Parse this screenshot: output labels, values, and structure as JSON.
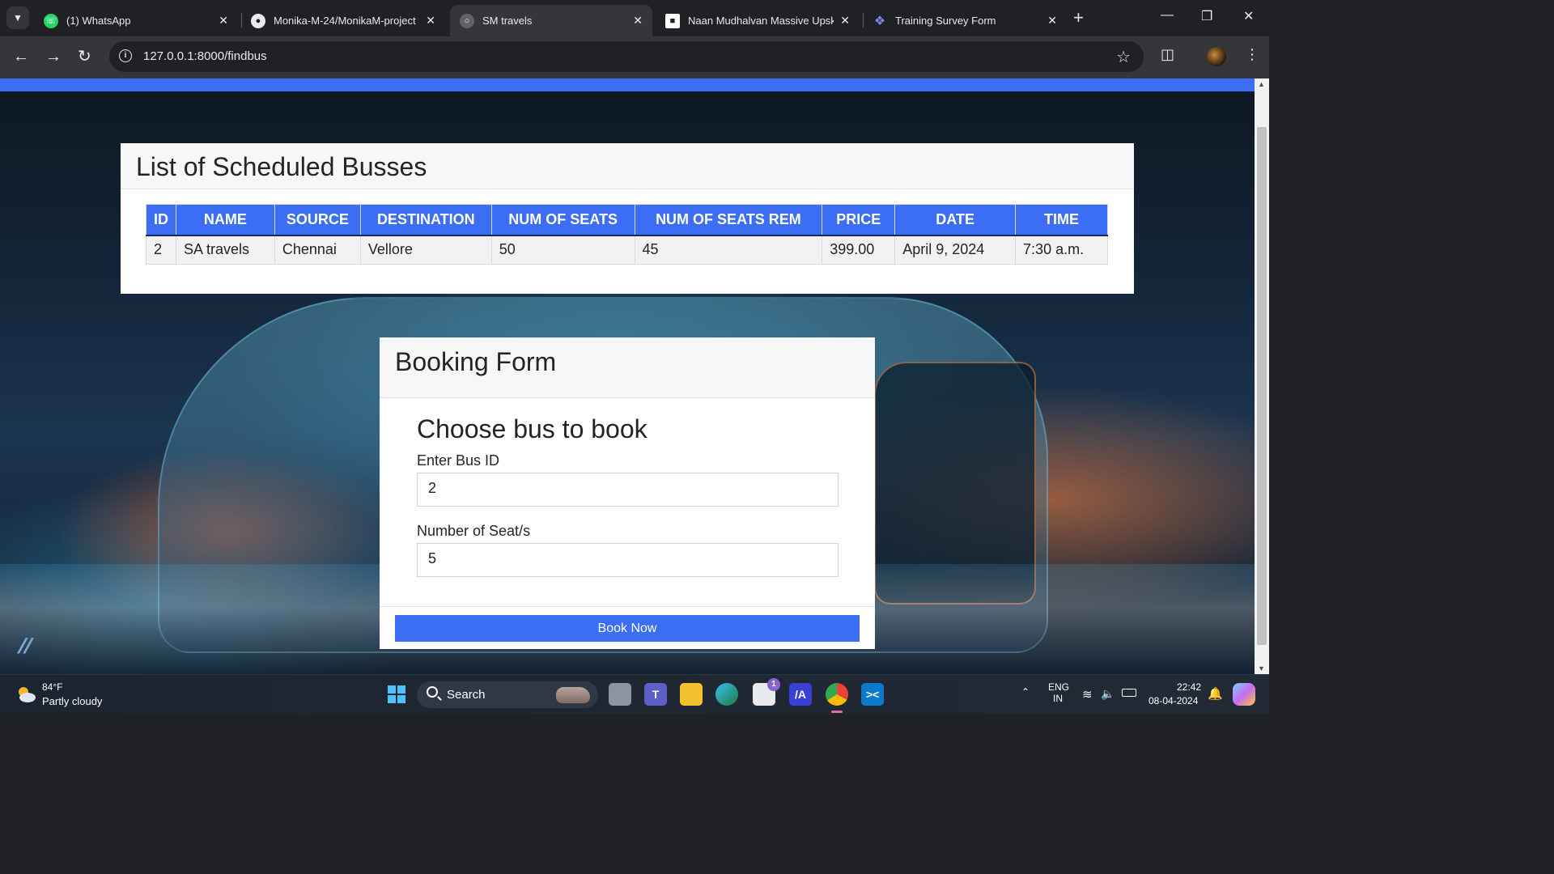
{
  "browser": {
    "tabs": [
      {
        "title": "(1) WhatsApp",
        "icon": "whatsapp-icon",
        "active": false
      },
      {
        "title": "Monika-M-24/MonikaM-project",
        "icon": "github-icon",
        "active": false
      },
      {
        "title": "SM travels",
        "icon": "globe-icon",
        "active": true
      },
      {
        "title": "Naan Mudhalvan Massive Upskil",
        "icon": "naan-mudhalvan-icon",
        "active": false
      },
      {
        "title": "Training Survey Form",
        "icon": "survey-icon",
        "active": false
      }
    ],
    "url": "127.0.0.1:8000/findbus",
    "accent_color": "#3b6ef5"
  },
  "schedule": {
    "heading": "List of Scheduled Busses",
    "columns": [
      "ID",
      "NAME",
      "SOURCE",
      "DESTINATION",
      "NUM OF SEATS",
      "NUM OF SEATS REM",
      "PRICE",
      "DATE",
      "TIME"
    ],
    "rows": [
      [
        "2",
        "SA travels",
        "Chennai",
        "Vellore",
        "50",
        "45",
        "399.00",
        "April 9, 2024",
        "7:30 a.m."
      ]
    ]
  },
  "booking": {
    "heading": "Booking Form",
    "subheading": "Choose bus to book",
    "bus_id_label": "Enter Bus ID",
    "bus_id_value": "2",
    "seats_label": "Number of Seat/s",
    "seats_value": "5",
    "submit_label": "Book Now"
  },
  "taskbar": {
    "weather_temp": "84°F",
    "weather_desc": "Partly cloudy",
    "search_label": "Search",
    "store_badge": "1",
    "language_line1": "ENG",
    "language_line2": "IN",
    "clock_time": "22:42",
    "clock_date": "08-04-2024"
  }
}
